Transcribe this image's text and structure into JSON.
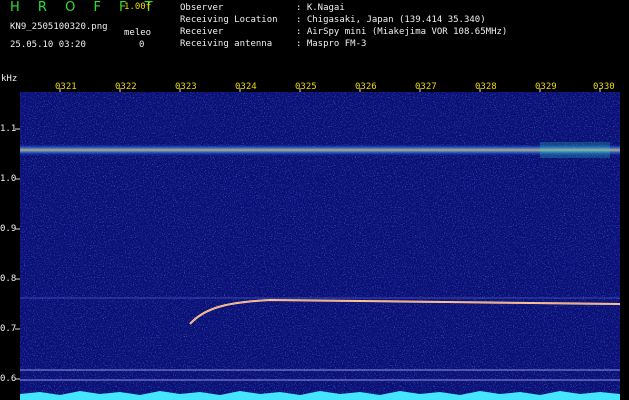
{
  "header": {
    "brand": "H R O F F T",
    "version": "1.00f",
    "filename": "KN9_2505100320.png",
    "meleo_label": "meleo",
    "meleo_value": "0",
    "datetime": "25.05.10 03:20",
    "info": [
      {
        "label": "Observer",
        "value": ": K.Nagai"
      },
      {
        "label": "Receiving Location",
        "value": ": Chigasaki, Japan (139.414 35.340)"
      },
      {
        "label": "Receiver",
        "value": ": AirSpy mini (Miakejima VOR 108.65MHz)"
      },
      {
        "label": "Receiving antenna",
        "value": ": Maspro FM-3"
      }
    ]
  },
  "axes": {
    "y_unit": "kHz",
    "y_ticks": [
      "1.1",
      "1.0",
      "0.9",
      "0.8",
      "0.7",
      "0.6"
    ],
    "x_ticks": [
      "0321",
      "0322",
      "0323",
      "0324",
      "0325",
      "0326",
      "0327",
      "0328",
      "0329",
      "0330"
    ]
  },
  "colors": {
    "background": "#0a0f74",
    "carrier": "#e4a040",
    "meteor_echo": "#ffe0a0",
    "baseline": "#44e6ff"
  }
}
